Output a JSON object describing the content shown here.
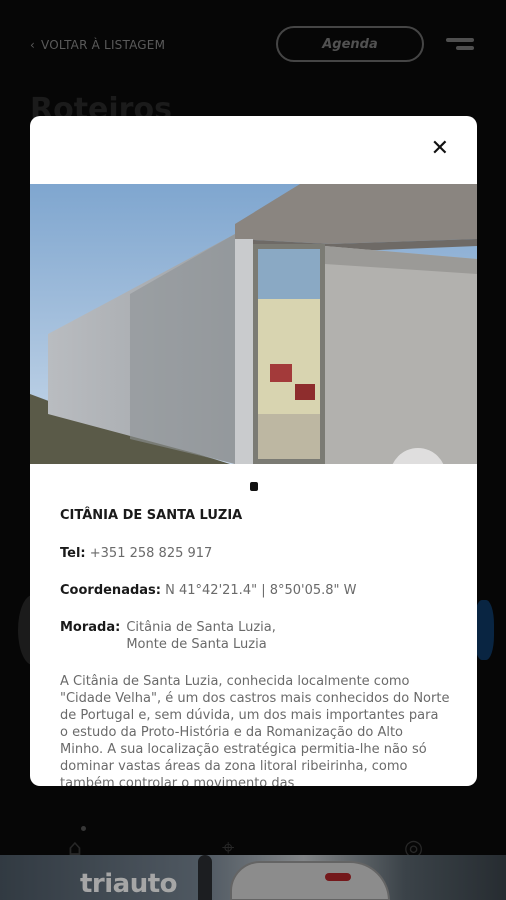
{
  "header": {
    "back_label": "VOLTAR À LISTAGEM",
    "agenda_label": "Agenda",
    "page_title": "Roteiros"
  },
  "modal": {
    "title": "CITÂNIA DE SANTA LUZIA",
    "tel_label": "Tel:",
    "tel_value": "+351 258 825 917",
    "coords_label": "Coordenadas:",
    "coords_value": "N 41°42'21.4\" | 8°50'05.8\" W",
    "morada_label": "Morada:",
    "morada_line1": "Citânia de Santa Luzia,",
    "morada_line2": "Monte de Santa Luzia",
    "description": "A Citânia de Santa Luzia, conhecida localmente como \"Cidade Velha\", é um dos castros mais conhecidos do Norte de Portugal e, sem dúvida, um dos mais importantes para o estudo da Proto-História e da Romanização do Alto Minho. A sua localização estratégica permitia-lhe não só dominar vastas áreas da zona litoral ribeirinha, como também controlar o movimento das"
  },
  "ad": {
    "brand": "triauto"
  },
  "icons": {
    "back": "chevron-left-icon",
    "menu": "menu-icon",
    "close": "close-icon",
    "favorite": "heart-icon"
  },
  "colors": {
    "background": "#0a0a0a",
    "modal": "#ffffff",
    "text_dark": "#1a1a1a",
    "text_muted": "#6a6a6a"
  }
}
